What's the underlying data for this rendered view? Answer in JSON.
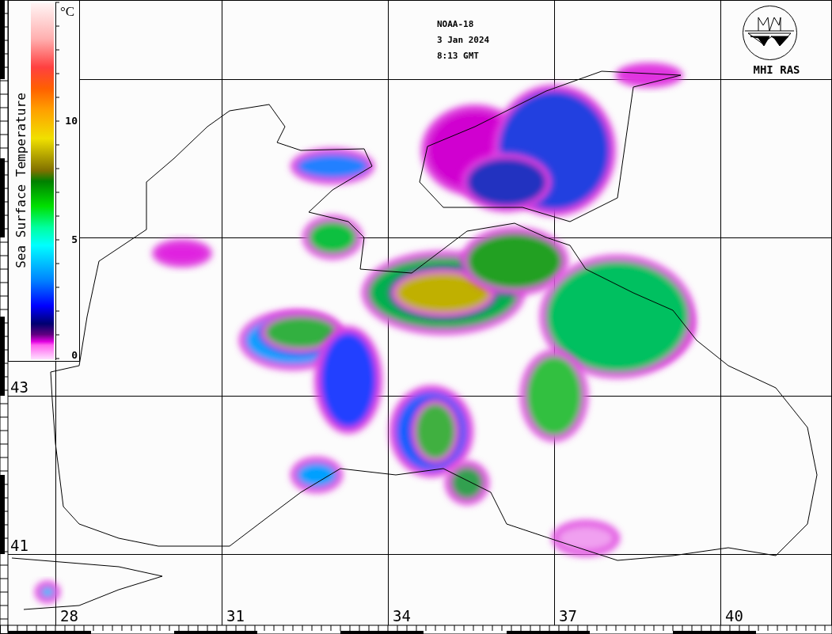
{
  "header": {
    "satellite": "NOAA-18",
    "date": "3 Jan 2024",
    "time": "8:13 GMT"
  },
  "logo": {
    "caption": "MHI RAS"
  },
  "legend": {
    "title": "Sea Surface Temperature",
    "unit": "°C",
    "ticks": [
      "10",
      "5",
      "0"
    ]
  },
  "longitude_labels": [
    "28",
    "31",
    "34",
    "37",
    "40"
  ],
  "latitude_labels": [
    "43",
    "41"
  ]
}
